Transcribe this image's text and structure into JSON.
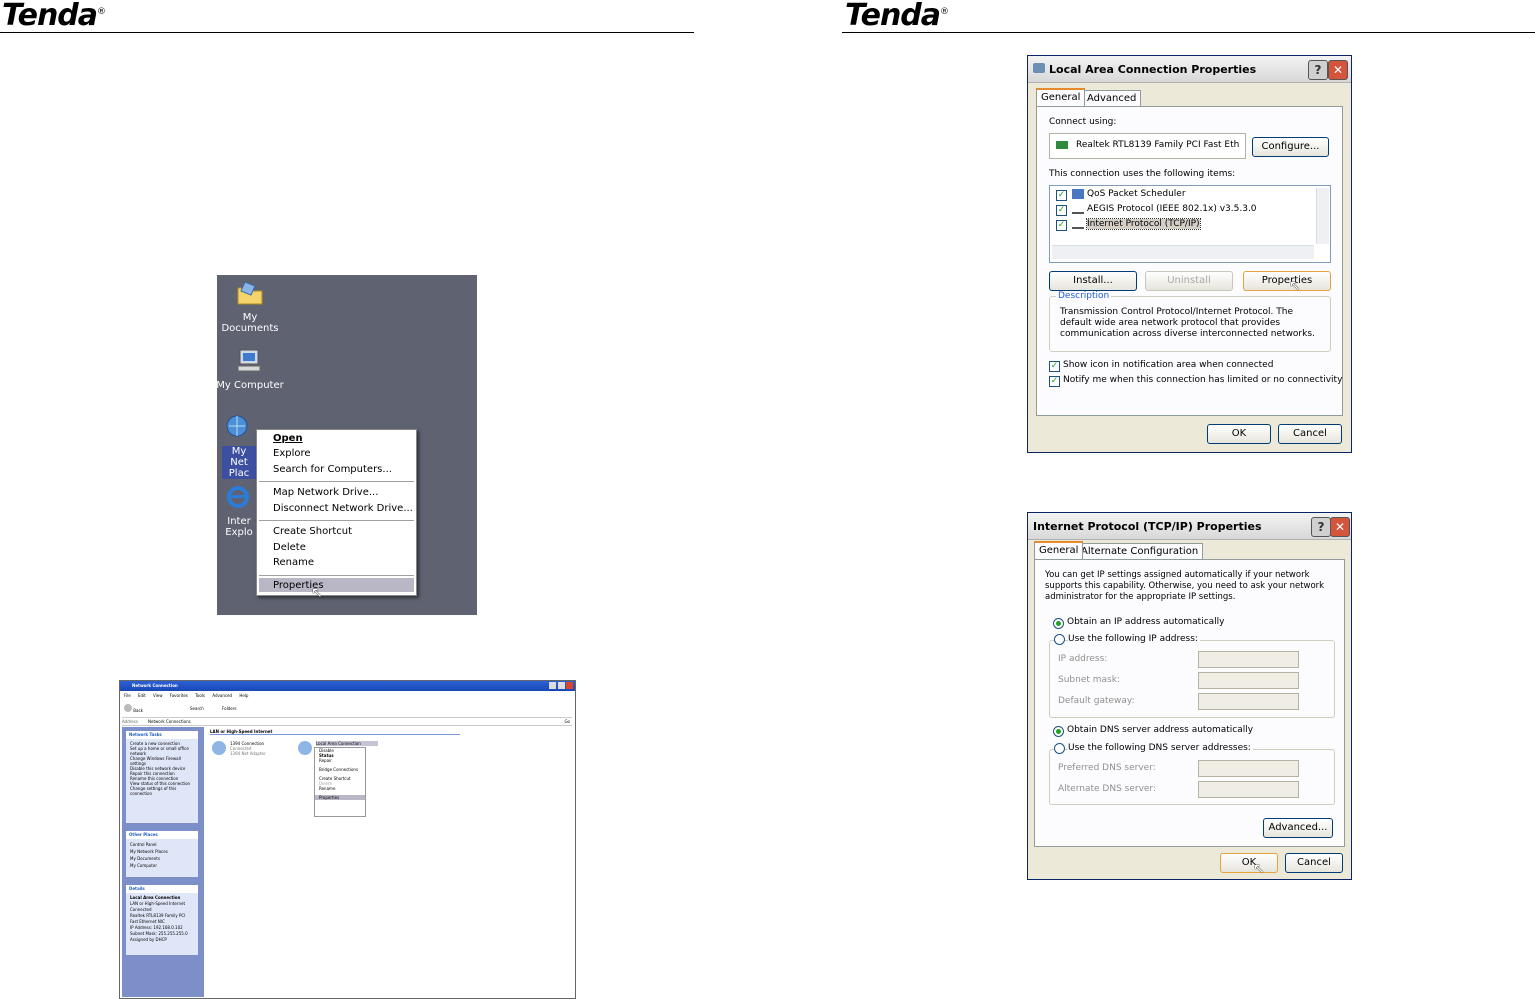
{
  "header": {
    "logo_left": "Tenda",
    "logo_right": "Tenda",
    "registered": "®"
  },
  "desktop": {
    "icons": [
      {
        "label": "My Documents"
      },
      {
        "label": "My Computer"
      },
      {
        "label": "My Net Plac"
      },
      {
        "label": "Inter Explo"
      }
    ],
    "context_menu": [
      "Open",
      "Explore",
      "Search for Computers...",
      "Map Network Drive...",
      "Disconnect Network Drive...",
      "Create Shortcut",
      "Delete",
      "Rename",
      "Properties"
    ]
  },
  "network_window": {
    "title": "Network Connection",
    "menu": [
      "File",
      "Edit",
      "View",
      "Favorites",
      "Tools",
      "Advanced",
      "Help"
    ],
    "toolbar": [
      "Back",
      "Search",
      "Folders"
    ],
    "address_label": "Address",
    "address_value": "Network Connections",
    "go": "Go",
    "section": "LAN or High-Speed Internet",
    "conn1": {
      "name": "1394 Connection",
      "status": "Connected",
      "device": "1394 Net Adapter"
    },
    "conn2": {
      "name": "Local Area Connection"
    },
    "tasks_title": "Network Tasks",
    "tasks": [
      "Create a new connection",
      "Set up a home or small office network",
      "Change Windows Firewall settings",
      "Disable this network device",
      "Repair this connection",
      "Rename this connection",
      "View status of this connection",
      "Change settings of this connection"
    ],
    "other_title": "Other Places",
    "other": [
      "Control Panel",
      "My Network Places",
      "My Documents",
      "My Computer"
    ],
    "details_title": "Details",
    "details": [
      "Local Area Connection",
      "LAN or High-Speed Internet",
      "Connected",
      "Realtek RTL8139 Family PCI",
      "Fast Ethernet NIC",
      "IP Address: 192.168.0.102",
      "Subnet Mask: 255.255.255.0",
      "Assigned by DHCP"
    ],
    "context_menu": [
      "Disable",
      "Status",
      "Repair",
      "Bridge Connections",
      "Create Shortcut",
      "Delete",
      "Rename",
      "Properties"
    ]
  },
  "lac_dialog": {
    "title": "Local Area Connection Properties",
    "tabs": [
      "General",
      "Advanced"
    ],
    "connect_using_label": "Connect using:",
    "adapter": "Realtek RTL8139 Family PCI Fast Eth",
    "configure": "Configure...",
    "items_label": "This connection uses the following items:",
    "items": [
      "QoS Packet Scheduler",
      "AEGIS Protocol (IEEE 802.1x) v3.5.3.0",
      "Internet Protocol (TCP/IP)"
    ],
    "install": "Install...",
    "uninstall": "Uninstall",
    "properties": "Properties",
    "description_label": "Description",
    "description": "Transmission Control Protocol/Internet Protocol. The default wide area network protocol that provides communication across diverse interconnected networks.",
    "check1": "Show icon in notification area when connected",
    "check2": "Notify me when this connection has limited or no connectivity",
    "ok": "OK",
    "cancel": "Cancel"
  },
  "tcp_dialog": {
    "title": "Internet Protocol (TCP/IP) Properties",
    "tabs": [
      "General",
      "Alternate Configuration"
    ],
    "intro": "You can get IP settings assigned automatically if your network supports this capability. Otherwise, you need to ask your network administrator for the appropriate IP settings.",
    "obtain_ip": "Obtain an IP address automatically",
    "use_ip": "Use the following IP address:",
    "ip_address": "IP address:",
    "subnet_mask": "Subnet mask:",
    "default_gateway": "Default gateway:",
    "obtain_dns": "Obtain DNS server address automatically",
    "use_dns": "Use the following DNS server addresses:",
    "preferred_dns": "Preferred DNS server:",
    "alternate_dns": "Alternate DNS server:",
    "advanced": "Advanced...",
    "ok": "OK",
    "cancel": "Cancel"
  }
}
